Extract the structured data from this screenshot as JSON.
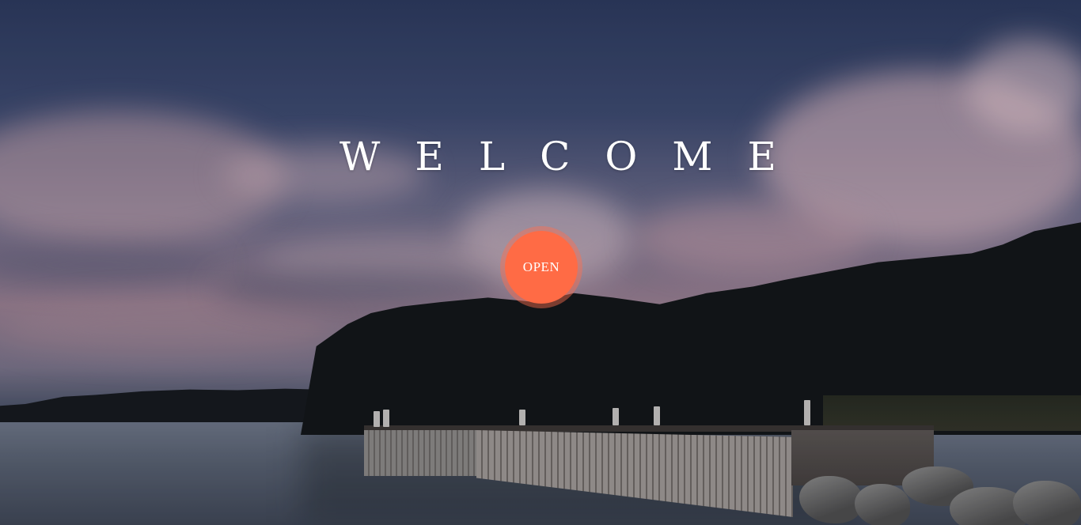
{
  "hero": {
    "title": "WELCOME",
    "background_image": "lake-dock-sunset-photo",
    "open_button_label": "OPEN",
    "accent_color": "#ff6b45"
  }
}
